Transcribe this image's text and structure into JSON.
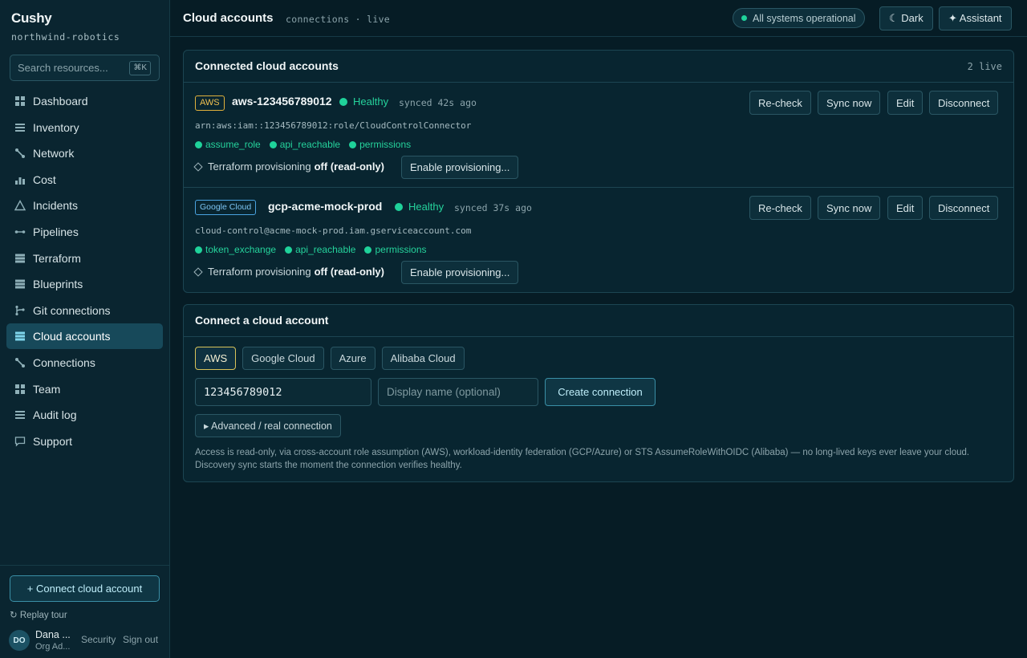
{
  "brand": {
    "name": "Cushy",
    "org": "northwind-robotics"
  },
  "search": {
    "placeholder": "Search resources...",
    "shortcut": "⌘K"
  },
  "nav": [
    {
      "label": "Dashboard",
      "icon": "grid-icon"
    },
    {
      "label": "Inventory",
      "icon": "list-icon"
    },
    {
      "label": "Network",
      "icon": "network-icon"
    },
    {
      "label": "Cost",
      "icon": "bar-chart-icon"
    },
    {
      "label": "Incidents",
      "icon": "triangle-icon"
    },
    {
      "label": "Pipelines",
      "icon": "pipeline-icon"
    },
    {
      "label": "Terraform",
      "icon": "stack-icon"
    },
    {
      "label": "Blueprints",
      "icon": "stack-icon"
    },
    {
      "label": "Git connections",
      "icon": "git-icon"
    },
    {
      "label": "Cloud accounts",
      "icon": "stack-icon",
      "active": true
    },
    {
      "label": "Connections",
      "icon": "network-icon"
    },
    {
      "label": "Team",
      "icon": "grid-icon"
    },
    {
      "label": "Audit log",
      "icon": "list-icon"
    },
    {
      "label": "Support",
      "icon": "chat-icon"
    }
  ],
  "sidebar_bottom": {
    "connect_label": "+ Connect cloud account",
    "replay_label": "Replay tour",
    "user_initials": "DO",
    "user_name": "Dana ...",
    "user_role": "Org Ad...",
    "security_label": "Security",
    "signout_label": "Sign out"
  },
  "topbar": {
    "title": "Cloud accounts",
    "subtitle": "connections · live",
    "status": "All systems operational",
    "theme_label": "☾ Dark",
    "assistant_label": "✦ Assistant"
  },
  "connected": {
    "title": "Connected cloud accounts",
    "count": "2 live",
    "accounts": [
      {
        "tag": "AWS",
        "name": "aws-123456789012",
        "health": "Healthy",
        "synced": "synced 42s ago",
        "identity": "arn:aws:iam::123456789012:role/CloudControlConnector",
        "checks": [
          "assume_role",
          "api_reachable",
          "permissions"
        ],
        "tf_label": "Terraform provisioning",
        "tf_state": "off (read-only)",
        "enable_label": "Enable provisioning..."
      },
      {
        "tag": "Google Cloud",
        "name": "gcp-acme-mock-prod",
        "health": "Healthy",
        "synced": "synced 37s ago",
        "identity": "cloud-control@acme-mock-prod.iam.gserviceaccount.com",
        "checks": [
          "token_exchange",
          "api_reachable",
          "permissions"
        ],
        "tf_label": "Terraform provisioning",
        "tf_state": "off (read-only)",
        "enable_label": "Enable provisioning..."
      }
    ],
    "actions": {
      "recheck": "Re-check",
      "sync": "Sync now",
      "edit": "Edit",
      "disconnect": "Disconnect"
    }
  },
  "connect": {
    "title": "Connect a cloud account",
    "providers": [
      "AWS",
      "Google Cloud",
      "Azure",
      "Alibaba Cloud"
    ],
    "selected_provider": "AWS",
    "account_id_value": "123456789012",
    "display_name_placeholder": "Display name (optional)",
    "create_label": "Create connection",
    "advanced_label": "▸ Advanced / real connection",
    "note": "Access is read-only, via cross-account role assumption (AWS), workload-identity federation (GCP/Azure) or STS AssumeRoleWithOIDC (Alibaba) — no long-lived keys ever leave your cloud. Discovery sync starts the moment the connection verifies healthy."
  }
}
